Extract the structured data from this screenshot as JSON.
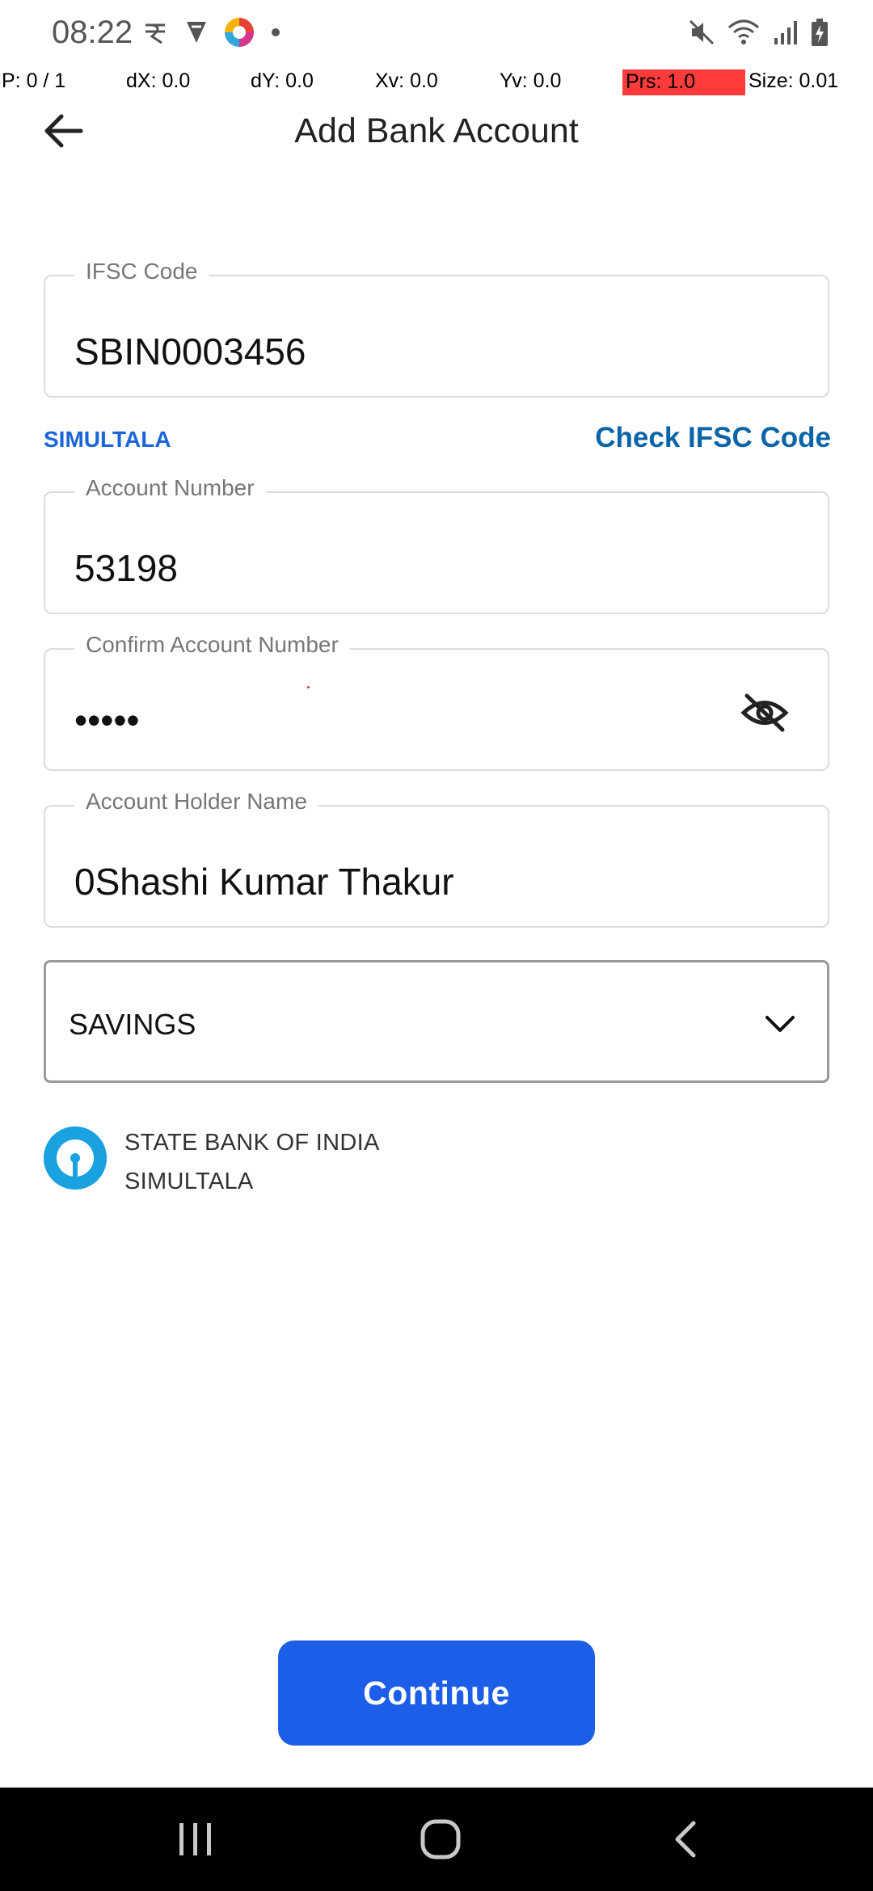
{
  "status_bar": {
    "time": "08:22",
    "left_icons": [
      "rupee-app-icon",
      "vpn-icon",
      "colorful-app-icon",
      "dot-icon"
    ],
    "right_icons": [
      "mute-icon",
      "wifi-icon",
      "signal-icon",
      "battery-icon"
    ]
  },
  "debug": {
    "p": "P: 0 / 1",
    "dx": "dX: 0.0",
    "dy": "dY: 0.0",
    "xv": "Xv: 0.0",
    "yv": "Yv: 0.0",
    "prs": "Prs: 1.0",
    "size": "Size: 0.01"
  },
  "header": {
    "title": "Add Bank Account",
    "back_icon": "arrow-left-icon"
  },
  "form": {
    "ifsc": {
      "label": "IFSC Code",
      "value": "SBIN0003456"
    },
    "branch_hint": "SIMULTALA",
    "check_ifsc_label": "Check IFSC Code",
    "account_number": {
      "label": "Account Number",
      "value": "53198"
    },
    "confirm_account_number": {
      "label": "Confirm Account Number",
      "value": "•••••",
      "toggle_icon": "eye-off-icon"
    },
    "account_holder_name": {
      "label": "Account Holder Name",
      "value": "0Shashi Kumar Thakur"
    },
    "account_type": {
      "selected": "SAVINGS",
      "icon": "chevron-down-icon"
    }
  },
  "bank_info": {
    "name": "STATE BANK OF INDIA",
    "branch": "SIMULTALA",
    "logo_icon": "sbi-logo-icon",
    "logo_color": "#1aa1e0"
  },
  "continue_label": "Continue",
  "colors": {
    "primary_button": "#1c5ee8",
    "link": "#0a64a8",
    "branch_hint": "#1a66d9"
  },
  "nav_bar": {
    "icons": [
      "recent-apps-icon",
      "home-icon",
      "back-icon"
    ]
  }
}
